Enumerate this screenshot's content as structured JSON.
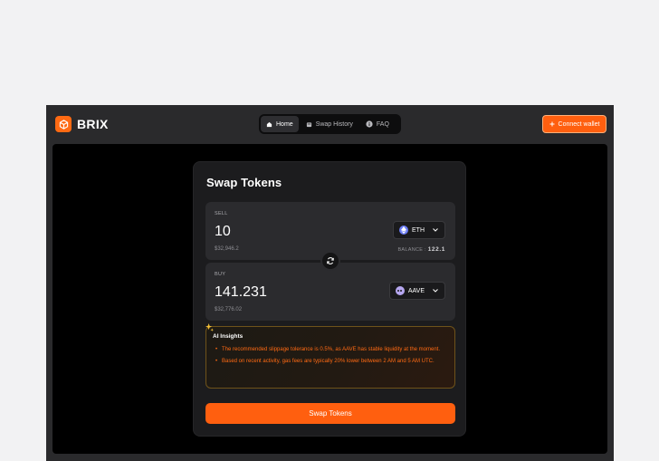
{
  "brand": {
    "name": "BRIX",
    "logo_icon": "cube-icon",
    "accent": "#ff6a13"
  },
  "nav": {
    "tabs": [
      {
        "label": "Home",
        "icon": "home-icon",
        "active": true
      },
      {
        "label": "Swap History",
        "icon": "calendar-icon",
        "active": false
      },
      {
        "label": "FAQ",
        "icon": "info-icon",
        "active": false
      }
    ]
  },
  "header": {
    "connect_label": "Connect wallet",
    "connect_icon": "plus-icon"
  },
  "swap": {
    "title": "Swap Tokens",
    "sell": {
      "label": "SELL",
      "amount": "10",
      "usd": "$32,946.2",
      "token": "ETH",
      "balance_label": "BALANCE :",
      "balance_value": "122.1"
    },
    "buy": {
      "label": "BUY",
      "amount": "141.231",
      "usd": "$32,776.02",
      "token": "AAVE"
    },
    "switch_icon": "refresh-icon",
    "button_label": "Swap Tokens"
  },
  "insights": {
    "title": "AI Insights",
    "items": [
      "The recommended slippage tolerance is 0.5%, as AAVE has stable liquidity at the moment.",
      "Based on recent activity, gas fees are typically 20% lower between 2 AM and 5 AM UTC."
    ]
  }
}
